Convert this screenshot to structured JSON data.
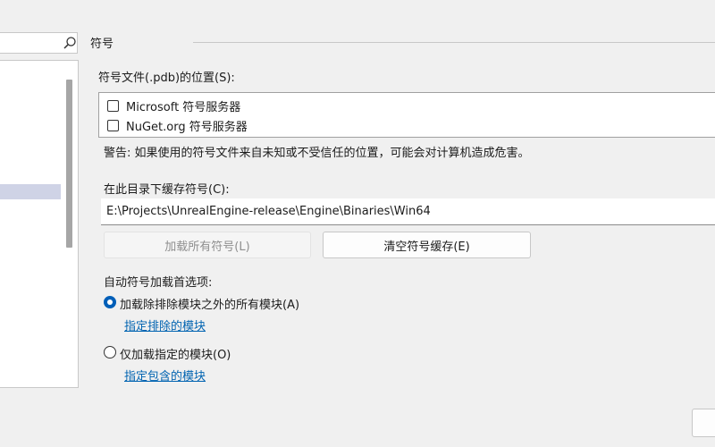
{
  "sidebar": {
    "search_icon": "search-icon"
  },
  "section": {
    "title": "符号"
  },
  "symbol_locations": {
    "label": "符号文件(.pdb)的位置(S):",
    "items": [
      {
        "label": "Microsoft 符号服务器",
        "checked": false
      },
      {
        "label": "NuGet.org 符号服务器",
        "checked": false
      }
    ],
    "warning": "警告: 如果使用的符号文件来自未知或不受信任的位置，可能会对计算机造成危害。"
  },
  "cache": {
    "label": "在此目录下缓存符号(C):",
    "path": "E:\\Projects\\UnrealEngine-release\\Engine\\Binaries\\Win64",
    "load_all_button": "加载所有符号(L)",
    "clear_cache_button": "清空符号缓存(E)"
  },
  "auto_load": {
    "label": "自动符号加载首选项:",
    "option_all": "加载除排除模块之外的所有模块(A)",
    "option_all_selected": true,
    "link_excluded": "指定排除的模块",
    "option_specified": "仅加载指定的模块(O)",
    "option_specified_selected": false,
    "link_included": "指定包含的模块"
  }
}
